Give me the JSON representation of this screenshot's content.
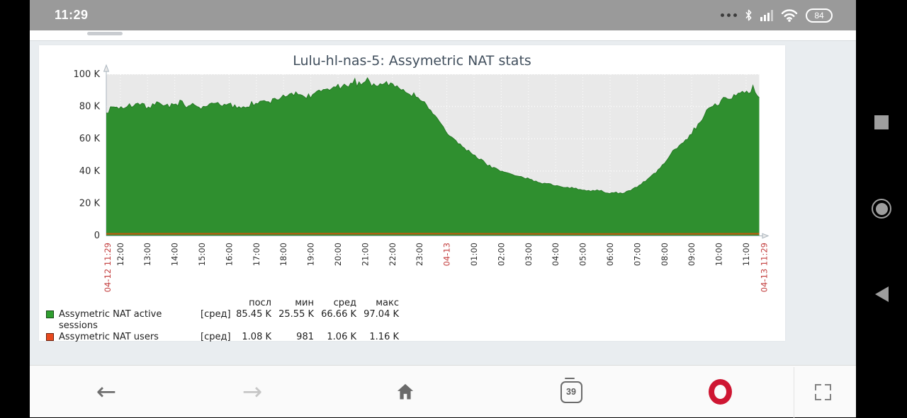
{
  "status_bar": {
    "time": "11:29",
    "battery_percent": "84"
  },
  "browser_page": {
    "card": {
      "title": "Lulu-hl-nas-5: Assymetric NAT stats"
    }
  },
  "chart_data": {
    "type": "area",
    "title": "Lulu-hl-nas-5: Assymetric NAT stats",
    "ylim": [
      0,
      100000
    ],
    "grid": true,
    "plot_bg": "#e9e9e9",
    "y_ticks": [
      {
        "label": "0",
        "v": 0
      },
      {
        "label": "20 K",
        "v": 20000
      },
      {
        "label": "40 K",
        "v": 40000
      },
      {
        "label": "60 K",
        "v": 60000
      },
      {
        "label": "80 K",
        "v": 80000
      },
      {
        "label": "100 K",
        "v": 100000
      }
    ],
    "x_start": {
      "label": "04-12 11:29",
      "red": true
    },
    "x_end": {
      "label": "04-13 11:29",
      "red": true
    },
    "first_tick_offset_hours": 0.5167,
    "duration_hours": 24,
    "x_hour_labels": [
      "12:00",
      "13:00",
      "14:00",
      "15:00",
      "16:00",
      "17:00",
      "18:00",
      "19:00",
      "20:00",
      "21:00",
      "22:00",
      "23:00",
      {
        "label": "04-13",
        "red": true
      },
      "01:00",
      "02:00",
      "03:00",
      "04:00",
      "05:00",
      "06:00",
      "07:00",
      "08:00",
      "09:00",
      "10:00",
      "11:00"
    ],
    "series": [
      {
        "name": "Assymetric NAT active sessions",
        "type": "area",
        "fill_color": "#2F8F2F",
        "line_color": "#267A26",
        "points": [
          [
            0,
            76000
          ],
          [
            0.25,
            80000
          ],
          [
            0.5,
            79000
          ],
          [
            1,
            81000
          ],
          [
            1.5,
            80000
          ],
          [
            2,
            82000
          ],
          [
            2.5,
            80000
          ],
          [
            3,
            81000
          ],
          [
            3.5,
            79000
          ],
          [
            4,
            81000
          ],
          [
            4.5,
            80000
          ],
          [
            5,
            80000
          ],
          [
            5.5,
            82000
          ],
          [
            6,
            83000
          ],
          [
            6.5,
            86000
          ],
          [
            7,
            87000
          ],
          [
            7.5,
            86000
          ],
          [
            8,
            90000
          ],
          [
            8.5,
            92000
          ],
          [
            9,
            93000
          ],
          [
            9.4,
            95000
          ],
          [
            9.6,
            97000
          ],
          [
            9.8,
            93000
          ],
          [
            10.2,
            95000
          ],
          [
            10.5,
            93000
          ],
          [
            10.8,
            92000
          ],
          [
            11,
            90000
          ],
          [
            11.3,
            87000
          ],
          [
            11.6,
            83000
          ],
          [
            11.9,
            79000
          ],
          [
            12.1,
            73000
          ],
          [
            12.3,
            69000
          ],
          [
            12.6,
            62000
          ],
          [
            13,
            56000
          ],
          [
            13.5,
            50000
          ],
          [
            14,
            44000
          ],
          [
            14.5,
            40000
          ],
          [
            15,
            37000
          ],
          [
            15.5,
            35000
          ],
          [
            16,
            32500
          ],
          [
            16.5,
            31000
          ],
          [
            17,
            29500
          ],
          [
            17.5,
            28500
          ],
          [
            18,
            27500
          ],
          [
            18.4,
            26500
          ],
          [
            19,
            26500
          ],
          [
            19.3,
            28000
          ],
          [
            19.6,
            31000
          ],
          [
            20,
            36000
          ],
          [
            20.5,
            44000
          ],
          [
            20.9,
            54000
          ],
          [
            21.4,
            61000
          ],
          [
            21.8,
            70000
          ],
          [
            22.2,
            80000
          ],
          [
            22.6,
            83000
          ],
          [
            23,
            86000
          ],
          [
            23.5,
            89000
          ],
          [
            23.8,
            90000
          ],
          [
            24,
            85450
          ]
        ]
      },
      {
        "name": "Assymetric NAT users",
        "type": "line",
        "fill_color": "#E8491D",
        "line_color": "#BA5C10",
        "points": [
          [
            0,
            1050
          ],
          [
            4,
            1100
          ],
          [
            8,
            1120
          ],
          [
            12,
            1160
          ],
          [
            16,
            1000
          ],
          [
            18,
            980
          ],
          [
            21,
            1020
          ],
          [
            24,
            1080
          ]
        ]
      }
    ]
  },
  "legend": {
    "headers": [
      "посл",
      "мин",
      "сред",
      "макс"
    ],
    "rows": [
      {
        "swatch": "#2F9E2F",
        "label": "Assymetric NAT active sessions",
        "func": "[сред]",
        "values": [
          "85.45 K",
          "25.55 K",
          "66.66 K",
          "97.04 K"
        ]
      },
      {
        "swatch": "#E8491D",
        "label": "Assymetric NAT users",
        "func": "[сред]",
        "values": [
          "1.08 K",
          "981",
          "1.06 K",
          "1.16 K"
        ]
      }
    ]
  },
  "toolbar": {
    "tab_count": "39",
    "icons": [
      "back-arrow-icon",
      "forward-arrow-icon",
      "home-icon",
      "tab-counter",
      "opera-logo-icon",
      "fullscreen-icon"
    ]
  },
  "android_nav": {
    "icons": [
      "recents-square-icon",
      "home-circle-icon",
      "back-triangle-icon"
    ]
  },
  "colors": {
    "status_bar_bg": "#9a9a9a",
    "page_bg": "#e9edf0",
    "card_bg": "#ffffff",
    "title_color": "#414f5d",
    "red_label": "#c23b3b",
    "tick_label": "#2d2d2d",
    "opera_red": "#ce1632"
  }
}
